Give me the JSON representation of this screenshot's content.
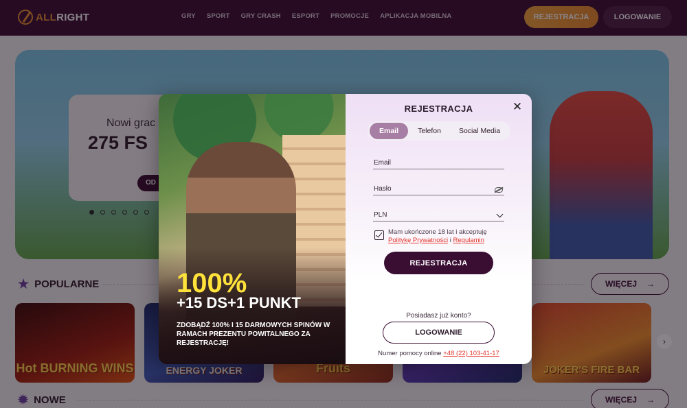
{
  "header": {
    "logo_text": "ALLRIGHT",
    "nav": [
      "GRY",
      "SPORT",
      "GRY CRASH",
      "ESPORT",
      "PROMOCJE",
      "APLIKACJA MOBILNA"
    ],
    "register_label": "REJESTRACJA",
    "login_label": "LOGOWANIE"
  },
  "hero": {
    "subtitle": "Nowi grac",
    "headline": "275 FS",
    "button_label": "OD"
  },
  "sections": {
    "popular_title": "POPULARNE",
    "new_title": "NOWE",
    "more_label": "WIĘCEJ",
    "games": [
      "Hot BURNING WINS",
      "ENERGY JOKER",
      "Fruits",
      "",
      "JOKER'S FIRE BAR"
    ]
  },
  "promo": {
    "percent": "100%",
    "bonus": "+15 DS+1 PUNKT",
    "description": "ZDOBĄDŹ 100% I 15 DARMOWYCH SPINÓW W RAMACH PREZENTU POWITALNEGO ZA REJESTRACJĘ!"
  },
  "form": {
    "title": "REJESTRACJA",
    "tabs": [
      "Email",
      "Telefon",
      "Social Media"
    ],
    "email_label": "Email",
    "password_label": "Hasło",
    "currency_value": "PLN",
    "consent_text": "Mam ukończone 18 lat i akceptuję",
    "privacy_link": "Politykę Prywatności",
    "and_word": "i",
    "terms_link": "Regulamin",
    "submit_label": "REJESTRACJA",
    "have_account": "Posiadasz już konto?",
    "login_label": "LOGOWANIE",
    "help_text": "Numer pomocy online",
    "help_phone": "+48 (22) 103-41-17"
  }
}
